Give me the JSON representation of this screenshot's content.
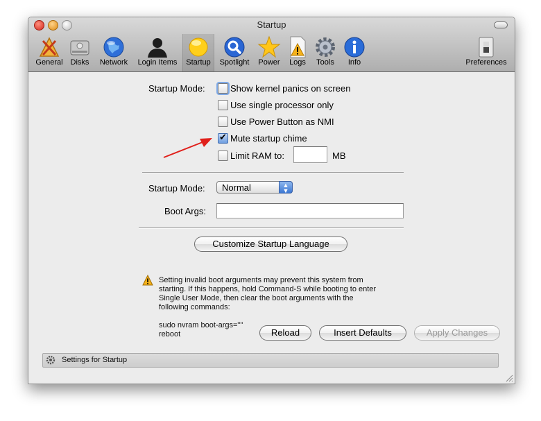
{
  "window": {
    "title": "Startup"
  },
  "toolbar": {
    "items": [
      {
        "label": "General"
      },
      {
        "label": "Disks"
      },
      {
        "label": "Network"
      },
      {
        "label": "Login Items"
      },
      {
        "label": "Startup"
      },
      {
        "label": "Spotlight"
      },
      {
        "label": "Power"
      },
      {
        "label": "Logs"
      },
      {
        "label": "Tools"
      },
      {
        "label": "Info"
      },
      {
        "label": "Preferences"
      }
    ],
    "selected": "Startup"
  },
  "startup_options": {
    "label": "Startup Mode:",
    "checkboxes": [
      {
        "label": "Show kernel panics on screen",
        "checked": false
      },
      {
        "label": "Use single processor only",
        "checked": false
      },
      {
        "label": "Use Power Button as NMI",
        "checked": false
      },
      {
        "label": "Mute startup chime",
        "checked": true
      },
      {
        "label": "Limit RAM to:",
        "checked": false
      }
    ],
    "ram_value": "",
    "ram_unit": "MB"
  },
  "mode": {
    "label": "Startup Mode:",
    "value": "Normal"
  },
  "boot_args": {
    "label": "Boot Args:",
    "value": ""
  },
  "customize_button": "Customize Startup Language",
  "warning": {
    "lines": [
      "Setting invalid boot arguments may prevent this system from",
      "starting. If this happens, hold Command-S while booting to enter",
      "Single User Mode, then clear the boot arguments with the",
      "following commands:",
      "",
      "sudo nvram boot-args=\"\"",
      "reboot"
    ]
  },
  "buttons": {
    "reload": "Reload",
    "insert_defaults": "Insert Defaults",
    "apply": "Apply Changes"
  },
  "status_bar": {
    "text": "Settings for Startup"
  },
  "colors": {
    "annotation_arrow": "#e0201b",
    "selected_tab_bg": "#b9b9b9",
    "checkbox_checked": "#6e9ee0"
  }
}
